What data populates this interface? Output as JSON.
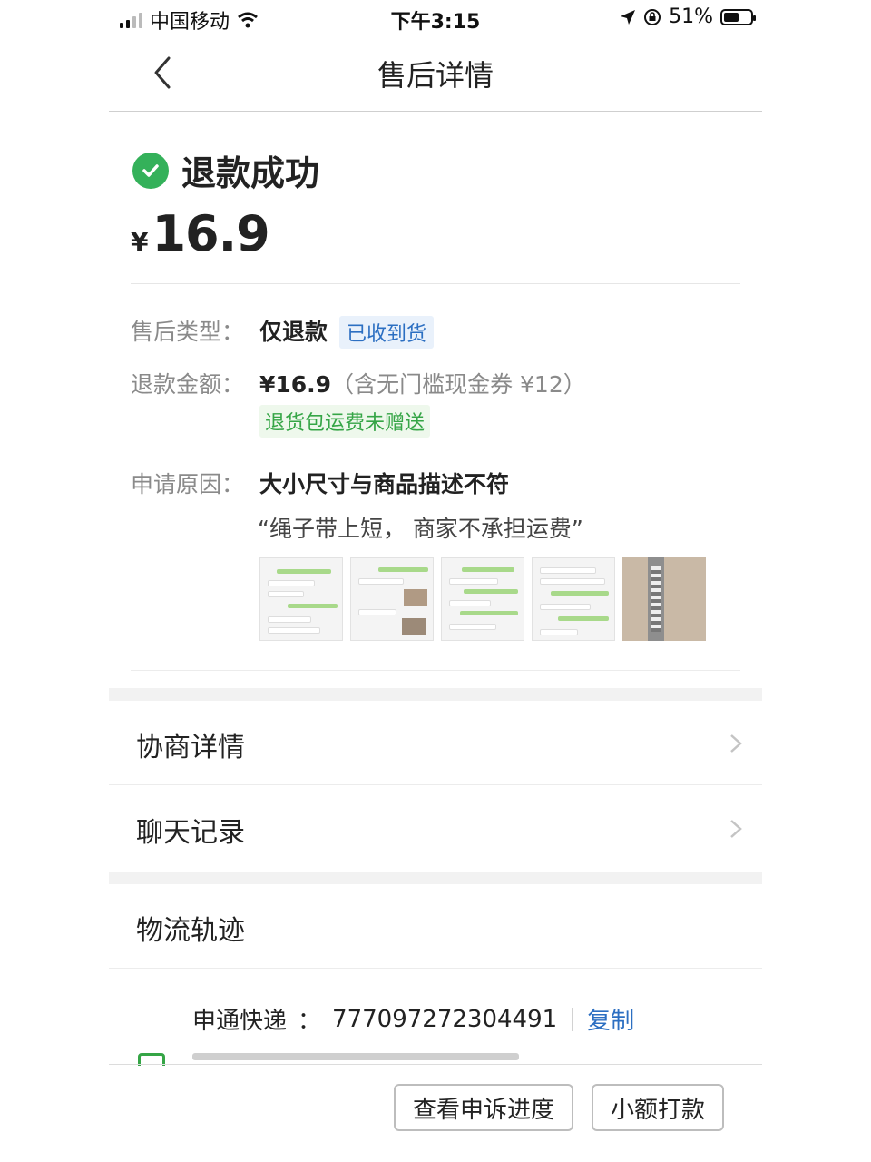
{
  "status_bar": {
    "carrier": "中国移动",
    "time": "下午3:15",
    "battery": "51%"
  },
  "nav": {
    "title": "售后详情"
  },
  "refund": {
    "status": "退款成功",
    "currency": "¥",
    "amount": "16.9"
  },
  "details": {
    "type_label": "售后类型：",
    "type_value": "仅退款",
    "type_tag": "已收到货",
    "amount_label": "退款金额：",
    "amount_value": "¥16.9",
    "amount_note": "（含无门槛现金券 ¥12）",
    "amount_tag": "退货包运费未赠送",
    "reason_label": "申请原因：",
    "reason_value": "大小尺寸与商品描述不符",
    "reason_quote": "“绳子带上短， 商家不承担运费”"
  },
  "menu": {
    "negotiation": "协商详情",
    "chat": "聊天记录",
    "logistics": "物流轨迹"
  },
  "logistics": {
    "carrier": "申通快递",
    "separator": "：",
    "tracking_no": "777097272304491",
    "copy": "复制"
  },
  "buttons": {
    "progress": "查看申诉进度",
    "pay": "小额打款"
  },
  "colors": {
    "success_green": "#34b15a",
    "link_blue": "#2c6fc2"
  }
}
